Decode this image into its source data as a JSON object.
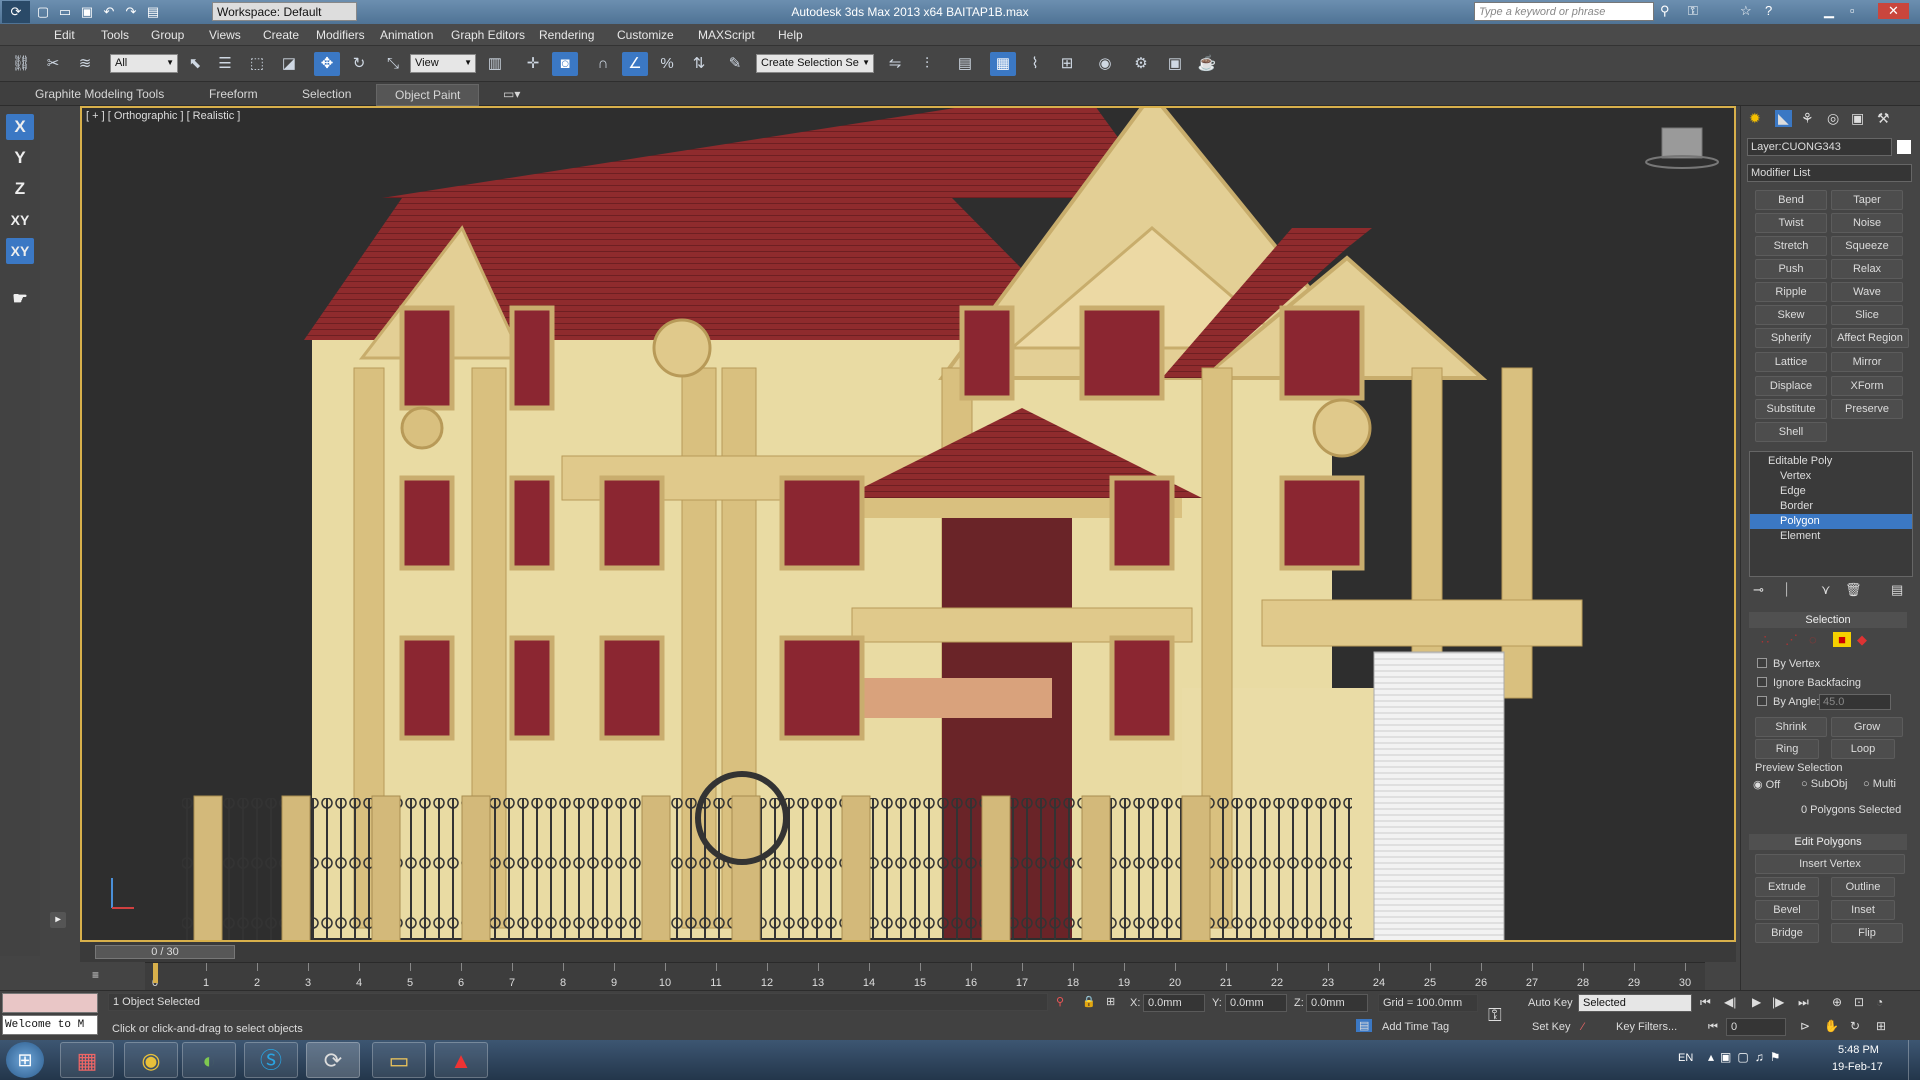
{
  "titlebar": {
    "title": "Autodesk 3ds Max  2013 x64     BAITAP1B.max",
    "workspace": "Workspace: Default",
    "search_placeholder": "Type a keyword or phrase"
  },
  "menu": [
    "Edit",
    "Tools",
    "Group",
    "Views",
    "Create",
    "Modifiers",
    "Animation",
    "Graph Editors",
    "Rendering",
    "Customize",
    "MAXScript",
    "Help"
  ],
  "toolbar": {
    "filter": "All",
    "ref_coord": "View",
    "named_selection": "Create Selection Se"
  },
  "ribbon": {
    "tabs": [
      "Graphite Modeling Tools",
      "Freeform",
      "Selection",
      "Object Paint"
    ],
    "active": "Object Paint"
  },
  "left_toolbar": [
    "X",
    "Y",
    "Z",
    "XY",
    "XY"
  ],
  "viewport": {
    "label": "[ + ] [ Orthographic ] [ Realistic ]"
  },
  "command_panel": {
    "layer": "Layer:CUONG343",
    "modifier_list": "Modifier List",
    "modifiers": [
      [
        "Bend",
        "Taper"
      ],
      [
        "Twist",
        "Noise"
      ],
      [
        "Stretch",
        "Squeeze"
      ],
      [
        "Push",
        "Relax"
      ],
      [
        "Ripple",
        "Wave"
      ],
      [
        "Skew",
        "Slice"
      ],
      [
        "Spherify",
        "Affect Region"
      ],
      [
        "Lattice",
        "Mirror"
      ],
      [
        "Displace",
        "XForm"
      ],
      [
        "Substitute",
        "Preserve"
      ],
      [
        "Shell",
        ""
      ]
    ],
    "stack": [
      "Editable Poly",
      "Vertex",
      "Edge",
      "Border",
      "Polygon",
      "Element"
    ],
    "stack_selected": "Polygon",
    "selection": {
      "header": "Selection",
      "by_vertex": "By Vertex",
      "ignore_backfacing": "Ignore Backfacing",
      "by_angle": "By Angle:",
      "angle": "45.0",
      "shrink": "Shrink",
      "grow": "Grow",
      "ring": "Ring",
      "loop": "Loop",
      "preview": "Preview Selection",
      "off": "Off",
      "subobj": "SubObj",
      "multi": "Multi",
      "count": "0 Polygons Selected"
    },
    "edit_polygons": {
      "header": "Edit Polygons",
      "insert_vertex": "Insert Vertex",
      "extrude": "Extrude",
      "outline": "Outline",
      "bevel": "Bevel",
      "inset": "Inset",
      "bridge": "Bridge",
      "flip": "Flip"
    }
  },
  "timeline": {
    "frame": "0 / 30",
    "ticks": [
      "0",
      "1",
      "2",
      "3",
      "4",
      "5",
      "6",
      "7",
      "8",
      "9",
      "10",
      "11",
      "12",
      "13",
      "14",
      "15",
      "16",
      "17",
      "18",
      "19",
      "20",
      "21",
      "22",
      "23",
      "24",
      "25",
      "26",
      "27",
      "28",
      "29",
      "30"
    ]
  },
  "status": {
    "maxscript": "Welcome to M",
    "selected": "1 Object Selected",
    "prompt": "Click or click-and-drag to select objects",
    "x_label": "X:",
    "x": "0.0mm",
    "y_label": "Y:",
    "y": "0.0mm",
    "z_label": "Z:",
    "z": "0.0mm",
    "grid": "Grid = 100.0mm",
    "add_time_tag": "Add Time Tag",
    "auto_key": "Auto Key",
    "set_key": "Set Key",
    "key_mode": "Selected",
    "key_filters": "Key Filters...",
    "current_frame": "0"
  },
  "taskbar": {
    "lang": "EN",
    "time": "5:48 PM",
    "date": "19-Feb-17"
  },
  "colors": {
    "accent": "#3b78c4",
    "roof": "#8b2a2a",
    "wall": "#e8d9a2"
  }
}
